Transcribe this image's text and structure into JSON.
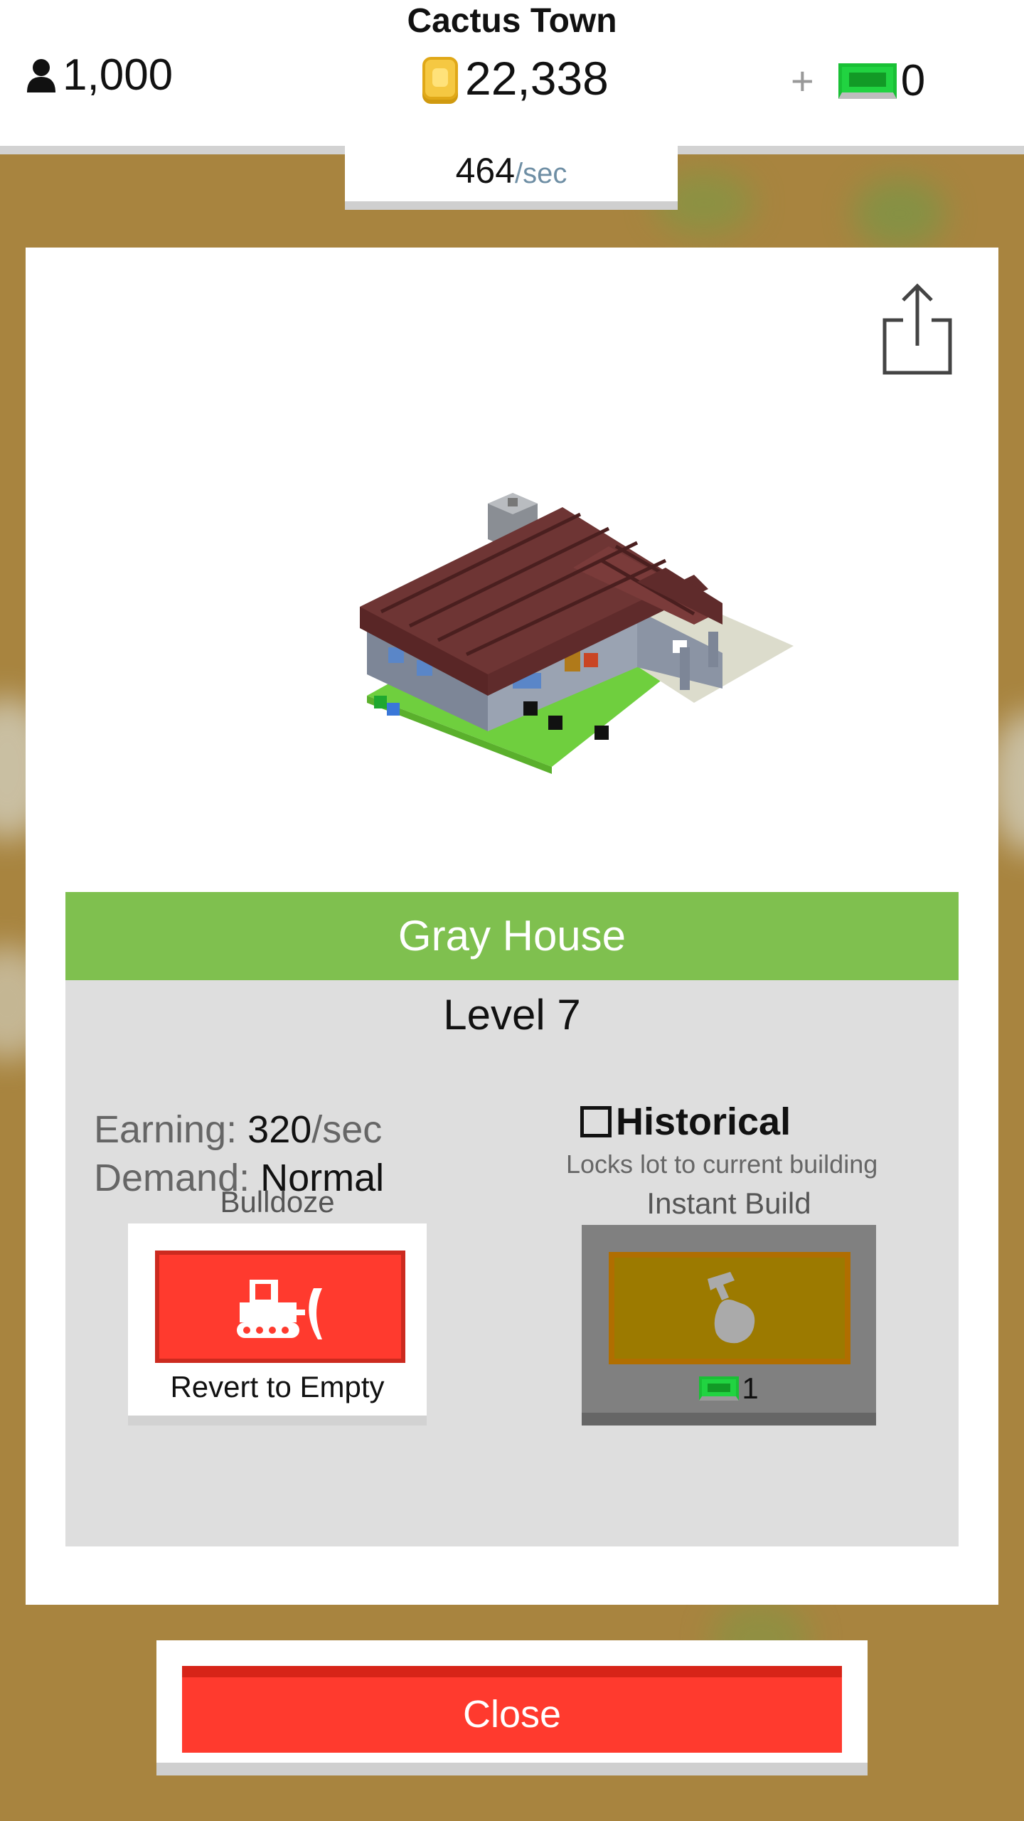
{
  "hud": {
    "town_name": "Cactus Town",
    "population": "1,000",
    "coins": "22,338",
    "cash": "0",
    "plus_label": "+",
    "rate_value": "464",
    "rate_unit": "/sec"
  },
  "building": {
    "name": "Gray House",
    "level": "Level 7",
    "earning_label": "Earning:",
    "earning_value": "320",
    "earning_unit": "/sec",
    "demand_label": "Demand:",
    "demand_value": "Normal",
    "historical_label": "Historical",
    "historical_desc": "Locks lot to current building",
    "historical_checked": false
  },
  "actions": {
    "bulldoze_caption": "Bulldoze",
    "bulldoze_text": "Revert to Empty",
    "instant_caption": "Instant Build",
    "instant_cost": "1",
    "close_label": "Close"
  },
  "colors": {
    "name_bar": "#7fc04f",
    "danger": "#ff3a2e",
    "cash_green": "#21d341",
    "ground": "#a8843f"
  }
}
